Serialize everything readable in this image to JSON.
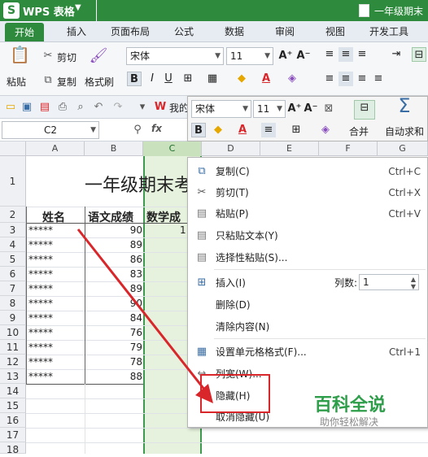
{
  "title_bar": {
    "app_name": "WPS 表格",
    "document_title": "一年级期末"
  },
  "tabs": [
    "开始",
    "插入",
    "页面布局",
    "公式",
    "数据",
    "审阅",
    "视图",
    "开发工具"
  ],
  "ribbon": {
    "paste": "粘贴",
    "cut": "剪切",
    "copy": "复制",
    "format_painter": "格式刷",
    "font_name": "宋体",
    "font_size": "11",
    "bold": "B",
    "italic": "I",
    "underline": "U"
  },
  "quick_bar": {
    "my_label": "我的"
  },
  "formula_bar": {
    "name_box": "C2",
    "fx": "fx"
  },
  "mini_toolbar": {
    "font_name": "宋体",
    "font_size": "11",
    "bold": "B",
    "merge": "合并",
    "autosum": "自动求和"
  },
  "columns": [
    "A",
    "B",
    "C",
    "D",
    "E",
    "F",
    "G"
  ],
  "rows": [
    "1",
    "2",
    "3",
    "4",
    "5",
    "6",
    "7",
    "8",
    "9",
    "10",
    "11",
    "12",
    "13",
    "14",
    "15",
    "16",
    "17",
    "18"
  ],
  "sheet": {
    "title": "一年级期末考",
    "header_name": "姓名",
    "header_chinese": "语文成绩",
    "header_math": "数学成",
    "c3": "1",
    "names": [
      "*****",
      "*****",
      "*****",
      "*****",
      "*****",
      "*****",
      "*****",
      "*****",
      "*****",
      "*****",
      "*****"
    ],
    "chinese_scores": [
      "90",
      "89",
      "86",
      "83",
      "89",
      "90",
      "84",
      "76",
      "79",
      "78",
      "88"
    ]
  },
  "context_menu": {
    "copy": "复制(C)",
    "copy_shortcut": "Ctrl+C",
    "cut": "剪切(T)",
    "cut_shortcut": "Ctrl+X",
    "paste": "粘贴(P)",
    "paste_shortcut": "Ctrl+V",
    "paste_text": "只粘贴文本(Y)",
    "paste_special": "选择性粘贴(S)...",
    "insert": "插入(I)",
    "col_count_label": "列数:",
    "col_count_value": "1",
    "delete": "删除(D)",
    "clear": "清除内容(N)",
    "format_cells": "设置单元格格式(F)...",
    "format_shortcut": "Ctrl+1",
    "col_width": "列宽(W)...",
    "hide": "隐藏(H)",
    "unhide": "取消隐藏(U)"
  },
  "watermark": {
    "brand": "百科全说",
    "slogan": "助你轻松解决"
  },
  "colors": {
    "accent_green": "#2e8b3e",
    "highlight_red": "#d9262a",
    "selection": "#e6f2dd"
  }
}
